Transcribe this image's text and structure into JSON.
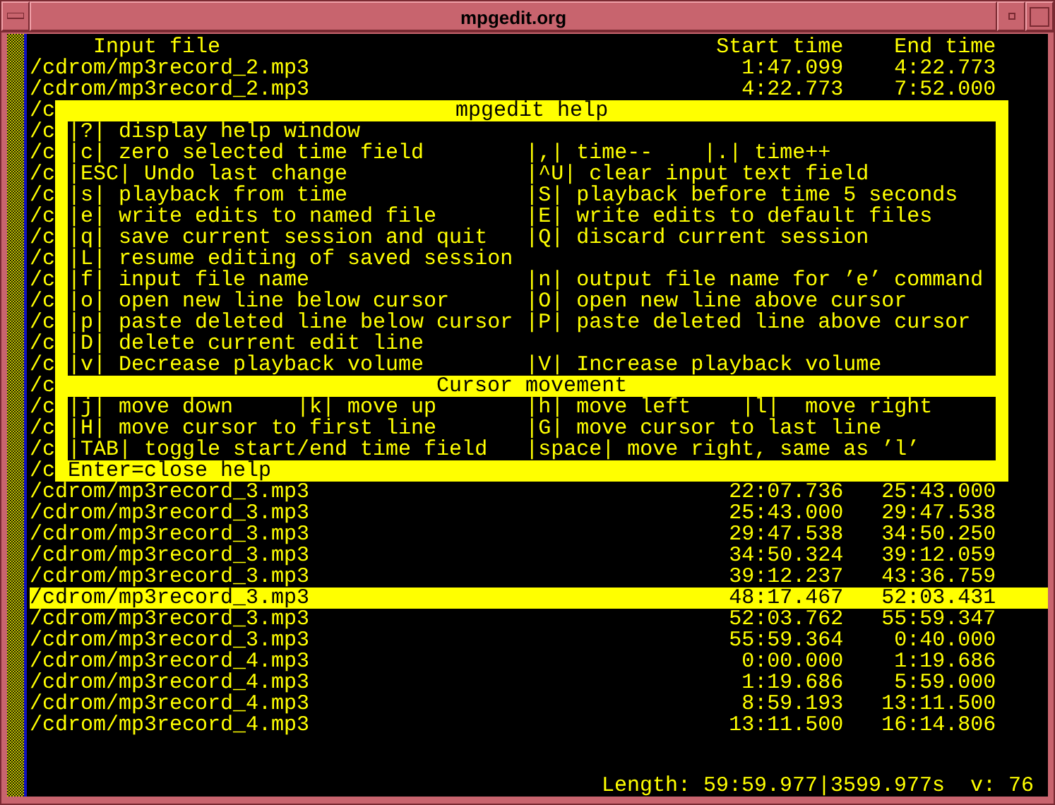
{
  "window": {
    "title": "mpgedit.org"
  },
  "file_list": {
    "columns": [
      "Input file",
      "Start time",
      "End time"
    ],
    "rows": [
      {
        "file": "/cdrom/mp3record_2.mp3",
        "start": "1:47.099",
        "end": "4:22.773",
        "selected": false
      },
      {
        "file": "/cdrom/mp3record_2.mp3",
        "start": "4:22.773",
        "end": "7:52.000",
        "selected": false
      },
      {
        "file": "/c"
      },
      {
        "file": "/c"
      },
      {
        "file": "/c"
      },
      {
        "file": "/c"
      },
      {
        "file": "/c"
      },
      {
        "file": "/c"
      },
      {
        "file": "/c"
      },
      {
        "file": "/c"
      },
      {
        "file": "/c"
      },
      {
        "file": "/c"
      },
      {
        "file": "/c"
      },
      {
        "file": "/c"
      },
      {
        "file": "/c"
      },
      {
        "file": "/c"
      },
      {
        "file": "/c"
      },
      {
        "file": "/c"
      },
      {
        "file": "/c"
      },
      {
        "file": "/c"
      },
      {
        "file": "/cdrom/mp3record_3.mp3",
        "start": "22:07.736",
        "end": "25:43.000",
        "selected": false
      },
      {
        "file": "/cdrom/mp3record_3.mp3",
        "start": "25:43.000",
        "end": "29:47.538",
        "selected": false
      },
      {
        "file": "/cdrom/mp3record_3.mp3",
        "start": "29:47.538",
        "end": "34:50.250",
        "selected": false
      },
      {
        "file": "/cdrom/mp3record_3.mp3",
        "start": "34:50.324",
        "end": "39:12.059",
        "selected": false
      },
      {
        "file": "/cdrom/mp3record_3.mp3",
        "start": "39:12.237",
        "end": "43:36.759",
        "selected": false
      },
      {
        "file": "/cdrom/mp3record_3.mp3",
        "start": "48:17.467",
        "end": "52:03.431",
        "selected": true
      },
      {
        "file": "/cdrom/mp3record_3.mp3",
        "start": "52:03.762",
        "end": "55:59.347",
        "selected": false
      },
      {
        "file": "/cdrom/mp3record_3.mp3",
        "start": "55:59.364",
        "end": "0:40.000",
        "selected": false
      },
      {
        "file": "/cdrom/mp3record_4.mp3",
        "start": "0:00.000",
        "end": "1:19.686",
        "selected": false
      },
      {
        "file": "/cdrom/mp3record_4.mp3",
        "start": "1:19.686",
        "end": "5:59.000",
        "selected": false
      },
      {
        "file": "/cdrom/mp3record_4.mp3",
        "start": "8:59.193",
        "end": "13:11.500",
        "selected": false
      },
      {
        "file": "/cdrom/mp3record_4.mp3",
        "start": "13:11.500",
        "end": "16:14.806",
        "selected": false
      }
    ]
  },
  "help": {
    "title": "mpgedit help",
    "commands": [
      {
        "left": "|?| display help window"
      },
      {
        "left": "|c| zero selected time field",
        "right": "|,| time--    |.| time++"
      },
      {
        "left": "|ESC| Undo last change",
        "right": "|^U| clear input text field"
      },
      {
        "left": "|s| playback from time",
        "right": "|S| playback before time 5 seconds"
      },
      {
        "left": "|e| write edits to named file",
        "right": "|E| write edits to default files"
      },
      {
        "left": "|q| save current session and quit",
        "right": "|Q| discard current session"
      },
      {
        "left": "|L| resume editing of saved session"
      },
      {
        "left": "|f| input file name",
        "right": "|n| output file name for ’e’ command"
      },
      {
        "left": "|o| open new line below cursor",
        "right": "|O| open new line above cursor"
      },
      {
        "left": "|p| paste deleted line below cursor",
        "right": "|P| paste deleted line above cursor"
      },
      {
        "left": "|D| delete current edit line"
      },
      {
        "left": "|v| Decrease playback volume",
        "right": "|V| Increase playback volume"
      }
    ],
    "section": "Cursor movement",
    "movement": [
      {
        "left": "|j| move down     |k| move up",
        "right": "|h| move left    |l|  move right"
      },
      {
        "left": "|H| move cursor to first line",
        "right": "|G| move cursor to last line"
      },
      {
        "left": "|TAB| toggle start/end time field",
        "right": "|space| move right, same as ’l’"
      }
    ],
    "footer": "Enter=close help"
  },
  "status_bar": "Length: 59:59.977|3599.977s  v: 76"
}
